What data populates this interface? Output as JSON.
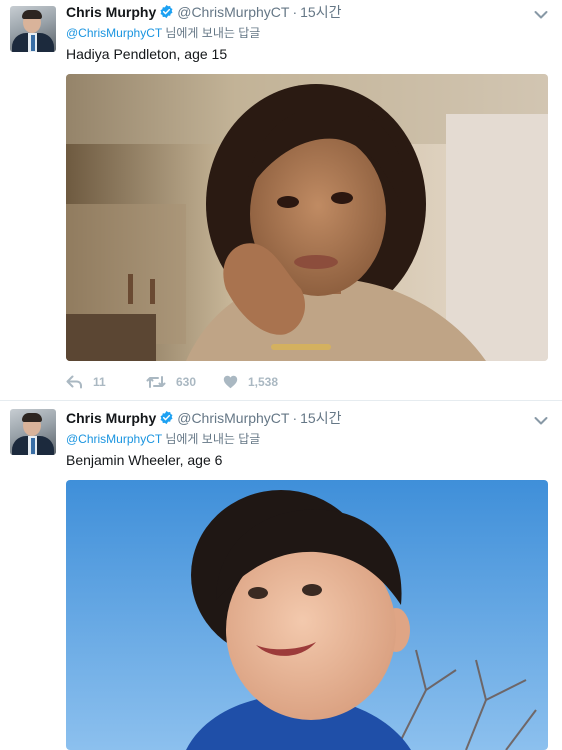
{
  "tweets": [
    {
      "author_name": "Chris Murphy",
      "handle": "@ChrisMurphyCT",
      "separator": "·",
      "time": "15시간",
      "reply_mention": "@ChrisMurphyCT",
      "reply_suffix": " 님에게 보내는 답글",
      "text": "Hadiya Pendleton, age 15",
      "reply_count": "11",
      "retweet_count": "630",
      "like_count": "1,538",
      "photo_description": "Photo of a teenage girl resting her chin on her hand"
    },
    {
      "author_name": "Chris Murphy",
      "handle": "@ChrisMurphyCT",
      "separator": "·",
      "time": "15시간",
      "reply_mention": "@ChrisMurphyCT",
      "reply_suffix": " 님에게 보내는 답글",
      "text": "Benjamin Wheeler, age 6",
      "photo_description": "Photo of a smiling young boy against a blue sky"
    }
  ],
  "icons": {
    "verified": "verified-badge-icon",
    "caret": "chevron-down-icon",
    "reply": "reply-icon",
    "retweet": "retweet-icon",
    "like": "heart-icon"
  },
  "colors": {
    "verified": "#1da1f2",
    "link": "#1b95e0",
    "muted": "#657786",
    "action": "#aab8c2"
  }
}
